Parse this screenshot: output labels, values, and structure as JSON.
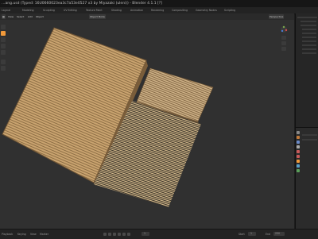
{
  "app": {
    "title": "…ang.usd (Typed: 16U0660023ea3c7a53e0527 x3 by Miyazaki (uleni)) - Blender 4.1.1 [?]"
  },
  "workspaces": [
    "Layout",
    "Modeling",
    "Sculpting",
    "UV Editing",
    "Texture Paint",
    "Shading",
    "Animation",
    "Rendering",
    "Compositing",
    "Geometry Nodes",
    "Scripting"
  ],
  "header": {
    "left_items": [
      "▦",
      "View",
      "Select",
      "Add",
      "Object"
    ],
    "mode": "Object Mode",
    "view_label": "Perspective"
  },
  "colors": {
    "viewport_bg": "#303030",
    "accent": "#f29a3a",
    "bamboo_light": "#d6b889",
    "bamboo_dark": "#8d6e45"
  },
  "timeline": {
    "playback_label": "Playback",
    "keying_label": "Keying",
    "view_label": "View",
    "marker_label": "Marker",
    "current_frame": "1",
    "start_label": "Start",
    "start": "1",
    "end_label": "End",
    "end": "250"
  },
  "icons": {
    "gizmo": "navigation-gizmo-icon",
    "tools": [
      "cursor-icon",
      "move-icon",
      "rotate-icon",
      "scale-icon",
      "transform-icon",
      "annotate-icon",
      "measure-icon"
    ]
  }
}
